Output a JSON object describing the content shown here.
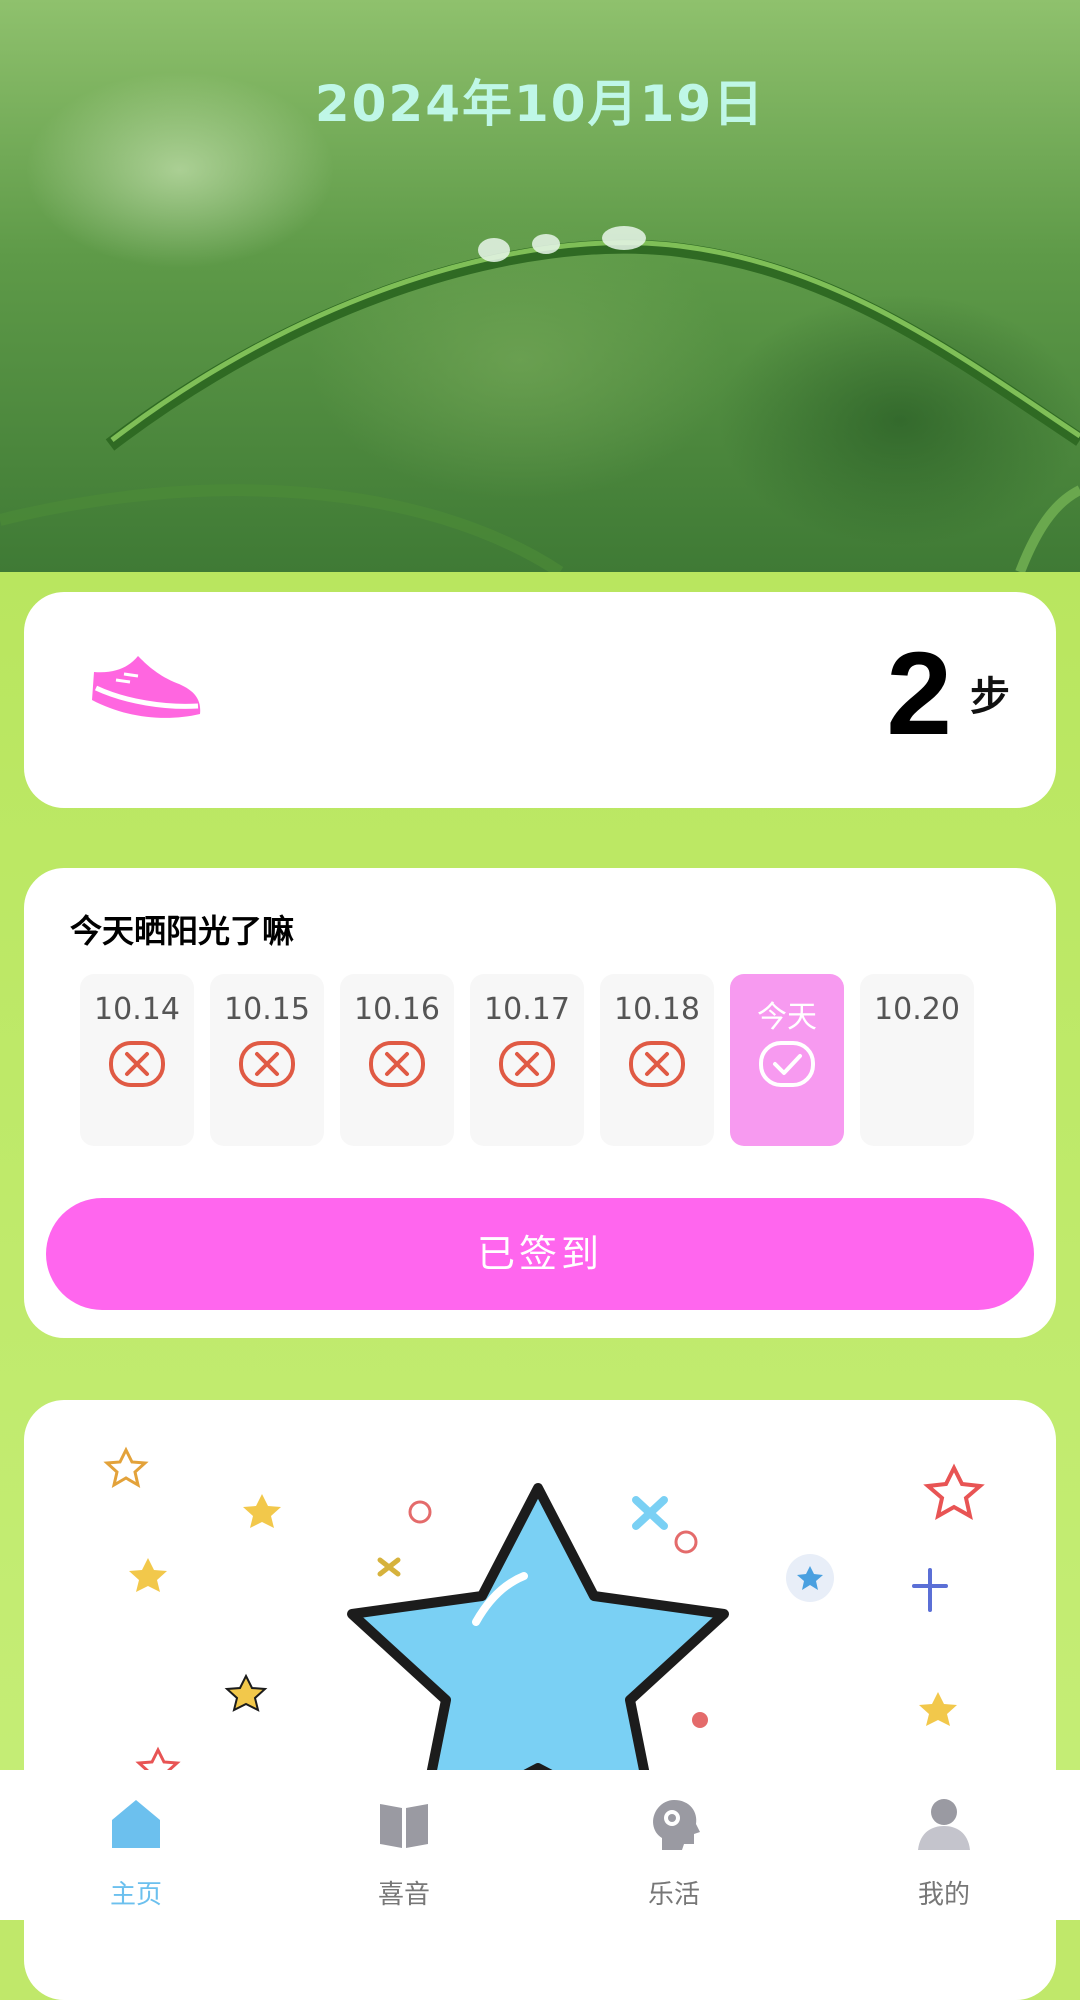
{
  "header": {
    "date": "2024年10月19日"
  },
  "steps": {
    "count": "2",
    "unit": "步",
    "icon": "running-shoe-icon"
  },
  "signin": {
    "title": "今天晒阳光了嘛",
    "days": [
      {
        "label": "10.14",
        "status": "missed"
      },
      {
        "label": "10.15",
        "status": "missed"
      },
      {
        "label": "10.16",
        "status": "missed"
      },
      {
        "label": "10.17",
        "status": "missed"
      },
      {
        "label": "10.18",
        "status": "missed"
      },
      {
        "label": "今天",
        "status": "checked"
      },
      {
        "label": "10.20",
        "status": "future"
      }
    ],
    "button_label": "已签到"
  },
  "tabs": [
    {
      "label": "主页",
      "icon": "home-icon",
      "active": true
    },
    {
      "label": "喜音",
      "icon": "book-icon",
      "active": false
    },
    {
      "label": "乐活",
      "icon": "head-brain-icon",
      "active": false
    },
    {
      "label": "我的",
      "icon": "profile-icon",
      "active": false
    }
  ],
  "colors": {
    "accent_pink": "#ff66ee",
    "today_pink": "#f79af0",
    "tab_active": "#6cc0ee",
    "page_green": "#c0e86a"
  }
}
